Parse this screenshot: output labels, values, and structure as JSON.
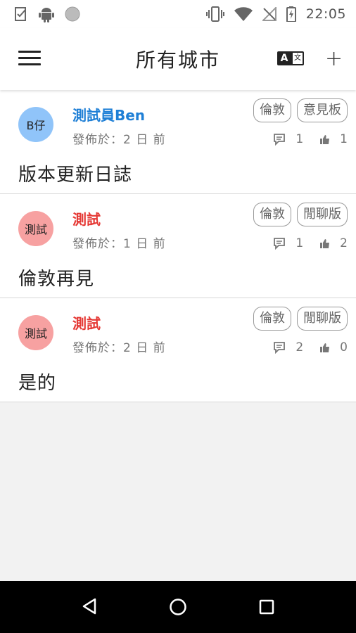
{
  "status_bar": {
    "time": "22:05",
    "icons_left": [
      "clipboard-check-icon",
      "android-icon",
      "circle-icon"
    ],
    "icons_right": [
      "vibrate-icon",
      "wifi-icon",
      "no-signal-icon",
      "battery-charging-icon"
    ]
  },
  "app_bar": {
    "title": "所有城市",
    "translate_a": "A",
    "translate_b": "文",
    "add": "+"
  },
  "posts": [
    {
      "avatar_text": "B仔",
      "avatar_color": "#90c4f9",
      "author": "測試員Ben",
      "author_color": "#1e7fd6",
      "meta": "發佈於：2 日 前",
      "tags": [
        "倫敦",
        "意見板"
      ],
      "comments": "1",
      "likes": "1",
      "title": "版本更新日誌"
    },
    {
      "avatar_text": "測試",
      "avatar_color": "#f7a1a1",
      "author": "測試",
      "author_color": "#e53935",
      "meta": "發佈於：1 日 前",
      "tags": [
        "倫敦",
        "閒聊版"
      ],
      "comments": "1",
      "likes": "2",
      "title": "倫敦再見"
    },
    {
      "avatar_text": "測試",
      "avatar_color": "#f7a1a1",
      "author": "測試",
      "author_color": "#e53935",
      "meta": "發佈於：2 日 前",
      "tags": [
        "倫敦",
        "閒聊版"
      ],
      "comments": "2",
      "likes": "0",
      "title": "是的"
    }
  ],
  "colors": {
    "background": "#f2f2f2",
    "card": "#ffffff",
    "nav_bar": "#000000"
  }
}
